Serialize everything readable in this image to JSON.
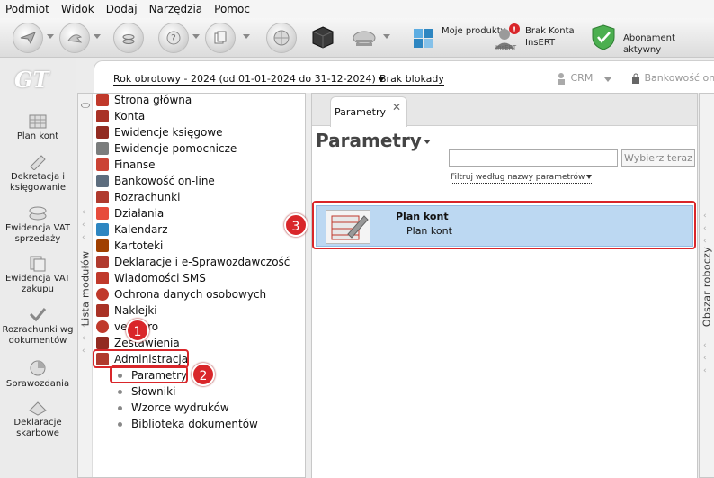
{
  "menu": [
    "Podmiot",
    "Widok",
    "Dodaj",
    "Narzędzia",
    "Pomoc"
  ],
  "toolbar": {
    "moje_produkty": "Moje produkty",
    "brak_konta": "Brak Konta InsERT",
    "abonament": "Abonament aktywny",
    "insert_badge": "InsERT"
  },
  "logo": "GT",
  "leftnav": {
    "items": [
      {
        "label": "Plan kont",
        "icon": "chart-of-accounts-icon"
      },
      {
        "label": "Dekretacja i księgowanie",
        "icon": "posting-icon"
      },
      {
        "label": "Ewidencja VAT sprzedaży",
        "icon": "vat-sales-icon"
      },
      {
        "label": "Ewidencja VAT zakupu",
        "icon": "vat-purchase-icon"
      },
      {
        "label": "Rozrachunki wg dokumentów",
        "icon": "settlements-icon"
      },
      {
        "label": "Sprawozdania",
        "icon": "reports-icon"
      },
      {
        "label": "Deklaracje skarbowe",
        "icon": "tax-declarations-icon"
      }
    ]
  },
  "contentbar": {
    "rok": "Rok obrotowy - 2024  (od 01-01-2024 do 31-12-2024)",
    "blokady": "Brak blokady",
    "crm": "CRM",
    "bank": "Bankowość on"
  },
  "modules": {
    "strip_label": "Lista modułów",
    "items": [
      {
        "label": "Strona główna",
        "color": "#c0392b"
      },
      {
        "label": "Konta",
        "color": "#a93226"
      },
      {
        "label": "Ewidencje księgowe",
        "color": "#922b21"
      },
      {
        "label": "Ewidencje pomocnicze",
        "color": "#7b7d7d"
      },
      {
        "label": "Finanse",
        "color": "#cb4335"
      },
      {
        "label": "Bankowość on-line",
        "color": "#5d6d7e"
      },
      {
        "label": "Rozrachunki",
        "color": "#b03a2e"
      },
      {
        "label": "Działania",
        "color": "#e74c3c"
      },
      {
        "label": "Kalendarz",
        "color": "#2e86c1"
      },
      {
        "label": "Kartoteki",
        "color": "#a04000"
      },
      {
        "label": "Deklaracje i e-Sprawozdawczość",
        "color": "#b03a2e"
      },
      {
        "label": "Wiadomości SMS",
        "color": "#c0392b"
      },
      {
        "label": "Ochrona danych osobowych",
        "color": "#c0392b"
      },
      {
        "label": "Naklejki",
        "color": "#a93226"
      },
      {
        "label": "vendero",
        "color": "#c0392b"
      },
      {
        "label": "Zestawienia",
        "color": "#922b21"
      },
      {
        "label": "Administracja",
        "color": "#b03a2e"
      }
    ],
    "subitems": [
      "Parametry",
      "Słowniki",
      "Wzorce wydruków",
      "Biblioteka dokumentów"
    ]
  },
  "markers": [
    "1",
    "2",
    "3"
  ],
  "main": {
    "tab_label": "Parametry",
    "tab_close": "✕",
    "title": "Parametry",
    "search_value": "",
    "wybierz": "Wybierz teraz",
    "filtr": "Filtruj według nazwy parametrów",
    "result_title": "Plan kont",
    "result_sub": "Plan kont"
  },
  "rightstrip_label": "Obszar roboczy",
  "colors": {
    "highlight": "#d9262a",
    "selection": "#bcd8f2"
  }
}
